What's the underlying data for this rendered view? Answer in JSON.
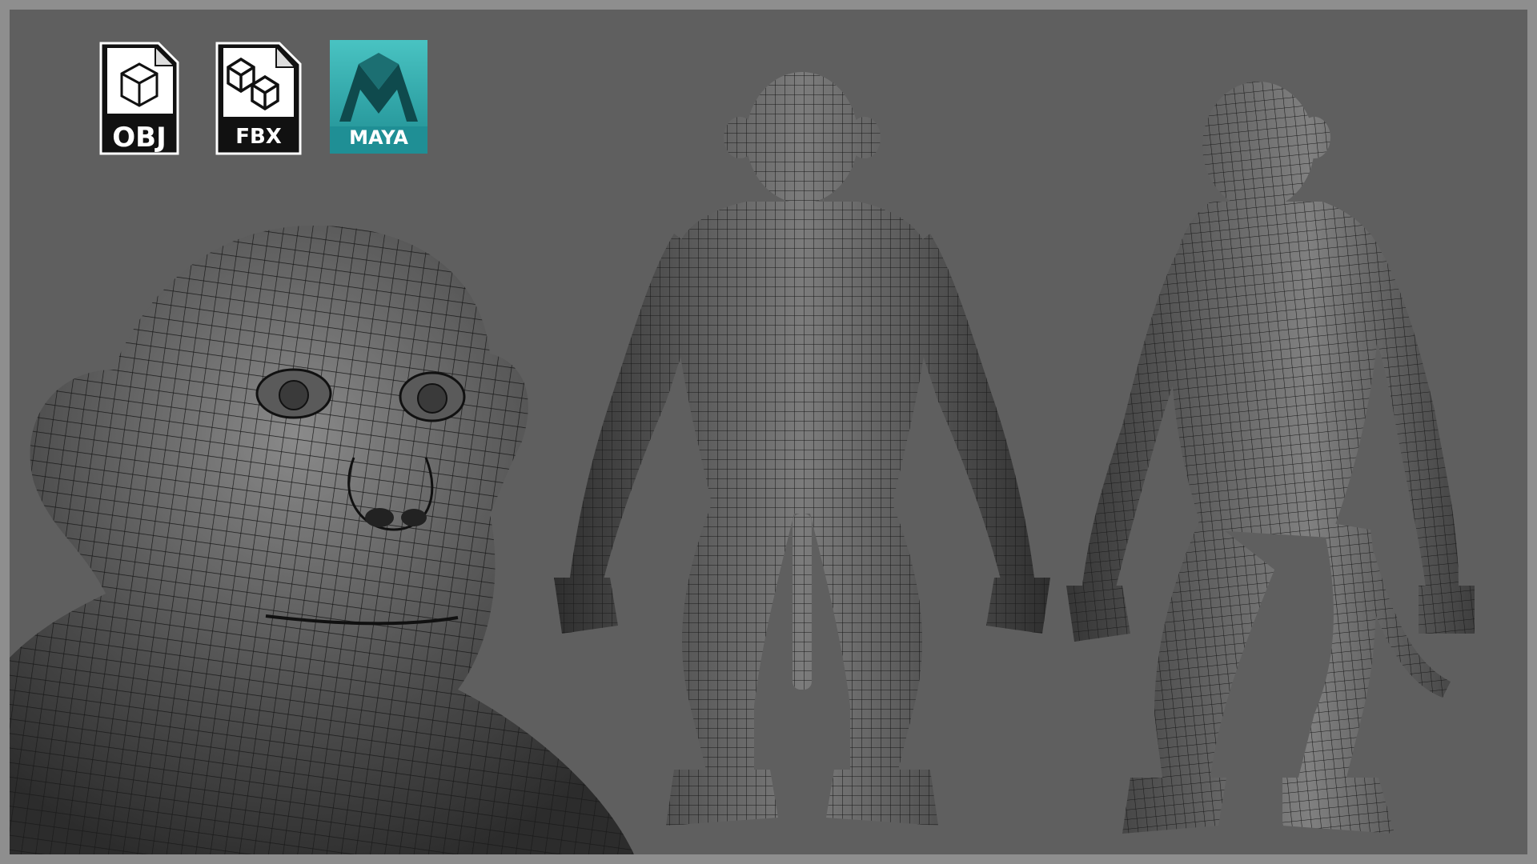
{
  "formats": {
    "obj_label": "OBJ",
    "fbx_label": "FBX",
    "maya_label": "MAYA"
  },
  "colors": {
    "background": "#5f5f5f",
    "frame": "#8e8e8e",
    "mesh_surface": "#4a4a4a",
    "wireframe": "#1c1c1c",
    "maya_teal": "#2aa0a6",
    "badge_black": "#111111"
  },
  "figures": {
    "head_view": "monkey-head-closeup-wireframe",
    "front_view": "monkey-front-full-body-wireframe",
    "side_view": "monkey-three-quarter-full-body-wireframe"
  }
}
